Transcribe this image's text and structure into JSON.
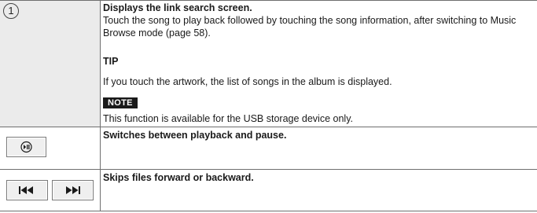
{
  "row1": {
    "number": "1",
    "heading": "Displays the link search screen.",
    "body": "Touch the song to play back followed by touching the song information, after switching to Music Browse mode (page 58).",
    "tip_label": "TIP",
    "tip_text": "If you touch the artwork, the list of songs in the album is displayed.",
    "note_label": "NOTE",
    "note_text": "This function is available for the USB storage device only."
  },
  "row2": {
    "icon": "play-pause-icon",
    "text": "Switches between playback and pause."
  },
  "row3": {
    "icons": [
      "skip-previous-icon",
      "skip-next-icon"
    ],
    "text": "Skips files forward or backward."
  }
}
